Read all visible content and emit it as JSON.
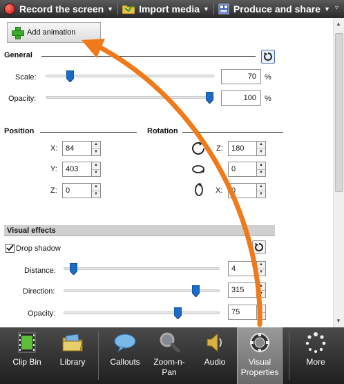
{
  "toolbar": {
    "record_label": "Record the screen",
    "import_label": "Import media",
    "produce_label": "Produce and share"
  },
  "panel": {
    "add_animation_label": "Add animation",
    "general": {
      "title": "General",
      "scale_label": "Scale:",
      "scale_value": "70",
      "scale_unit": "%",
      "opacity_label": "Opacity:",
      "opacity_value": "100",
      "opacity_unit": "%"
    },
    "position": {
      "title": "Position",
      "x_label": "X:",
      "x_value": "84",
      "y_label": "Y:",
      "y_value": "403",
      "z_label": "Z:",
      "z_value": "0"
    },
    "rotation": {
      "title": "Rotation",
      "z_label": "Z:",
      "z_value": "180",
      "y_value": "0",
      "x_label": "X:",
      "x_value": "0"
    },
    "visual_effects": {
      "title": "Visual effects",
      "drop_shadow_label": "Drop shadow",
      "drop_shadow_checked": true,
      "distance_label": "Distance:",
      "distance_value": "4",
      "direction_label": "Direction:",
      "direction_value": "315",
      "opacity_label": "Opacity:",
      "opacity_value": "75"
    }
  },
  "tabs": [
    {
      "label": "Clip Bin"
    },
    {
      "label": "Library"
    },
    {
      "label": "Callouts"
    },
    {
      "label": "Zoom-n-\nPan"
    },
    {
      "label": "Audio"
    },
    {
      "label": "Visual\nProperties"
    },
    {
      "label": "More"
    }
  ],
  "colors": {
    "arrow": "#f07a1a",
    "accent_blue": "#1a6cc8"
  }
}
